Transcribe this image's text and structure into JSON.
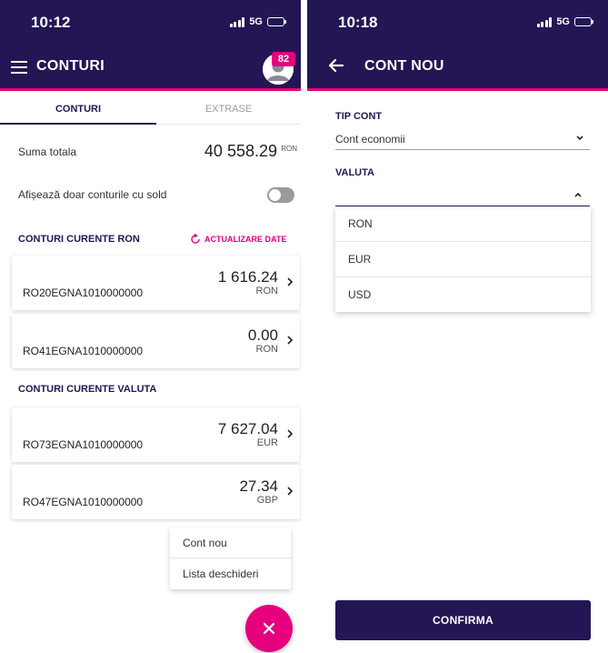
{
  "colors": {
    "primary": "#241654",
    "accent": "#e6007e",
    "text": "#222222",
    "muted": "#9a9a9a"
  },
  "left_screen": {
    "status_bar": {
      "time": "10:12",
      "network": "5G"
    },
    "app_bar": {
      "title": "CONTURI",
      "menu_icon": "hamburger-icon",
      "notifications_count": "82"
    },
    "tabs": [
      {
        "label": "CONTURI",
        "active": true
      },
      {
        "label": "EXTRASE",
        "active": false
      }
    ],
    "total": {
      "label": "Suma totala",
      "value": "40 558.29",
      "currency": "RON"
    },
    "filter": {
      "label": "Afișează doar conturile cu sold",
      "enabled": false
    },
    "sections": [
      {
        "title": "CONTURI CURENTE RON",
        "action_label": "ACTUALIZARE DATE",
        "accounts": [
          {
            "iban": "RO20EGNA1010000000",
            "amount": "1 616.24",
            "currency": "RON"
          },
          {
            "iban": "RO41EGNA1010000000",
            "amount": "0.00",
            "currency": "RON"
          }
        ]
      },
      {
        "title": "CONTURI CURENTE VALUTA",
        "accounts": [
          {
            "iban": "RO73EGNA1010000000",
            "amount": "7 627.04",
            "currency": "EUR"
          },
          {
            "iban": "RO47EGNA1010000000",
            "amount": "27.34",
            "currency": "GBP"
          }
        ]
      }
    ],
    "fab_menu": [
      {
        "label": "Cont nou"
      },
      {
        "label": "Lista deschideri"
      }
    ]
  },
  "right_screen": {
    "status_bar": {
      "time": "10:18",
      "network": "5G"
    },
    "app_bar": {
      "title": "CONT NOU"
    },
    "account_type": {
      "label": "TIP CONT",
      "value": "Cont economii"
    },
    "currency": {
      "label": "VALUTA",
      "value": "",
      "options": [
        "RON",
        "EUR",
        "USD"
      ]
    },
    "confirm_label": "CONFIRMA"
  }
}
